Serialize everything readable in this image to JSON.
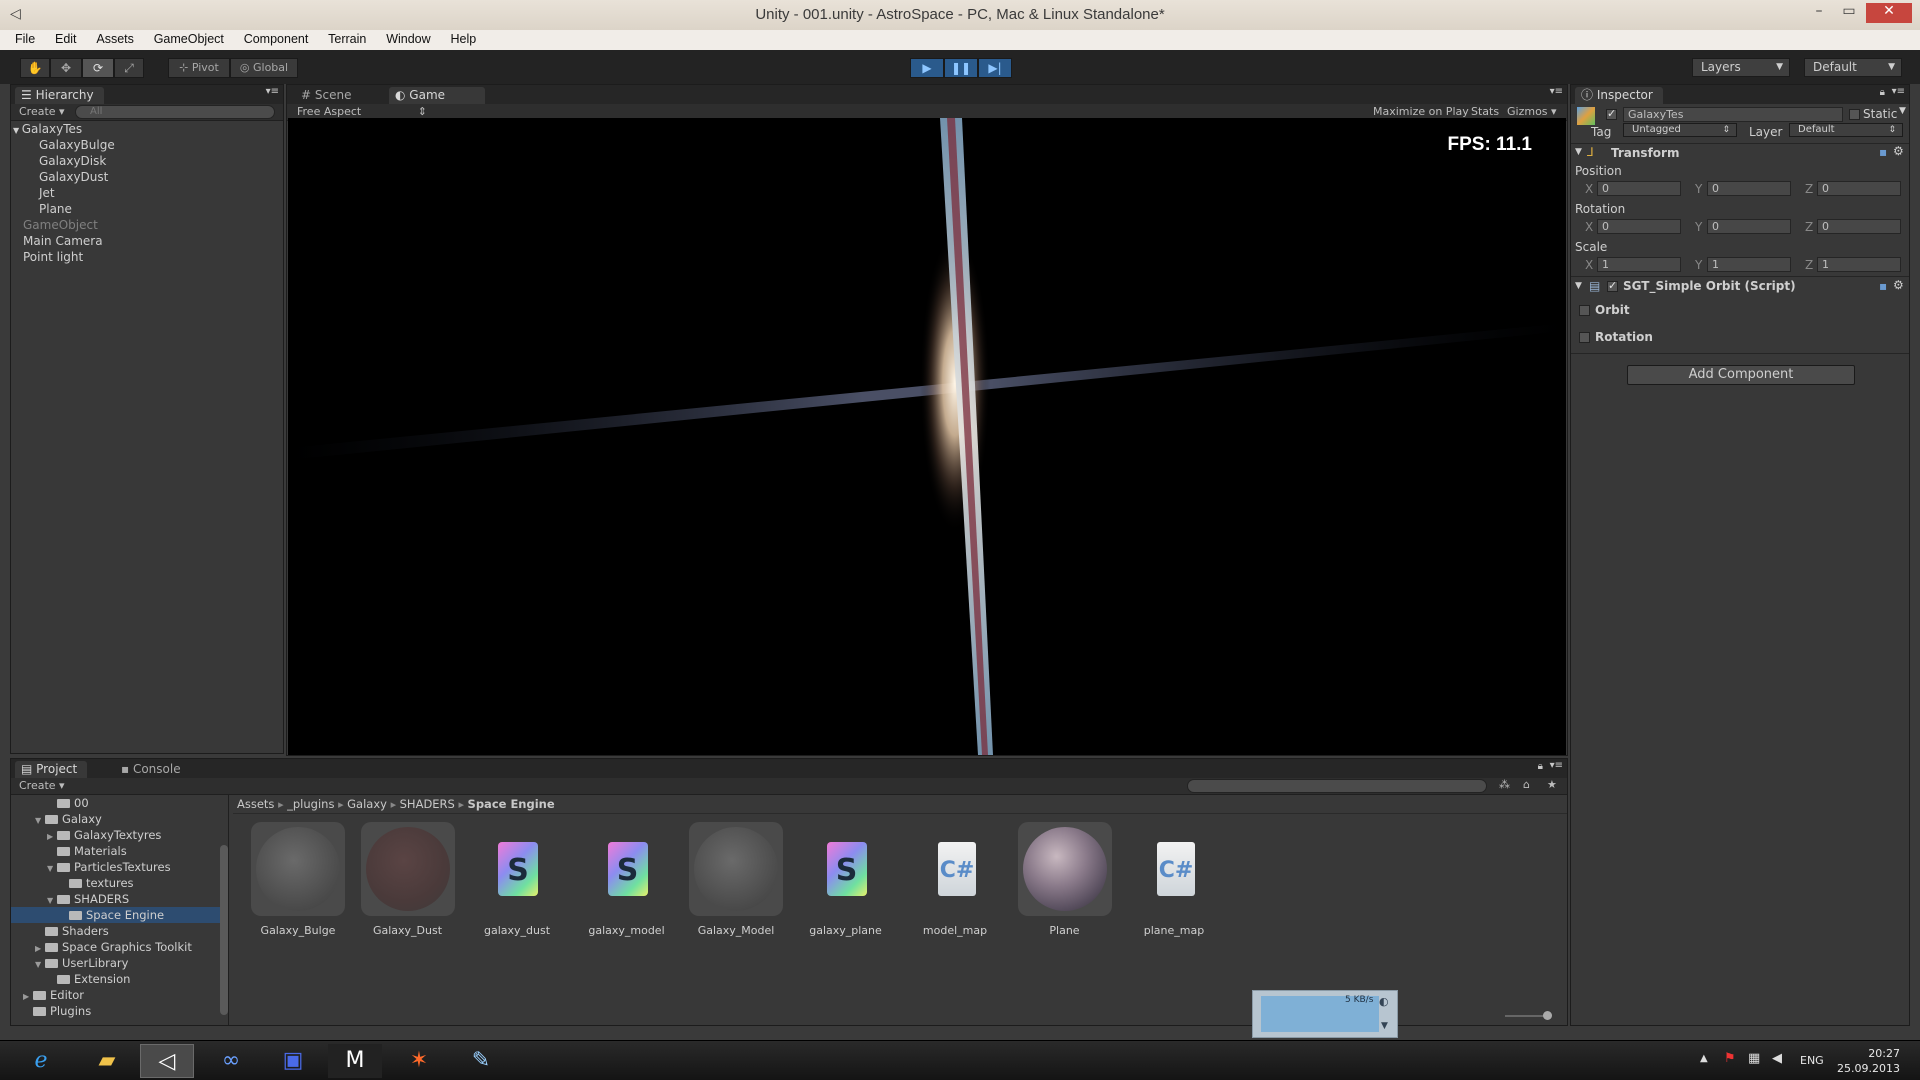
{
  "window": {
    "title": "Unity - 001.unity - AstroSpace - PC, Mac & Linux Standalone*"
  },
  "menu": [
    "File",
    "Edit",
    "Assets",
    "GameObject",
    "Component",
    "Terrain",
    "Window",
    "Help"
  ],
  "toolbar": {
    "pivot": "Pivot",
    "global": "Global",
    "layers": "Layers",
    "layout": "Default"
  },
  "hierarchy": {
    "tab": "Hierarchy",
    "create": "Create",
    "search_placeholder": "All",
    "items": [
      {
        "label": "GalaxyTes",
        "indent": 0,
        "dim": false,
        "expanded": true
      },
      {
        "label": "GalaxyBulge",
        "indent": 1,
        "dim": false
      },
      {
        "label": "GalaxyDisk",
        "indent": 1,
        "dim": false
      },
      {
        "label": "GalaxyDust",
        "indent": 1,
        "dim": false
      },
      {
        "label": "Jet",
        "indent": 1,
        "dim": false
      },
      {
        "label": "Plane",
        "indent": 1,
        "dim": false
      },
      {
        "label": "GameObject",
        "indent": 0,
        "dim": true
      },
      {
        "label": "Main Camera",
        "indent": 0,
        "dim": false
      },
      {
        "label": "Point light",
        "indent": 0,
        "dim": false
      }
    ]
  },
  "views": {
    "scene_tab": "Scene",
    "game_tab": "Game",
    "aspect": "Free Aspect",
    "maximize": "Maximize on Play",
    "stats": "Stats",
    "gizmos": "Gizmos",
    "fps": "FPS: 11.1"
  },
  "inspector": {
    "tab": "Inspector",
    "object_name": "GalaxyTes",
    "static": "Static",
    "tag_label": "Tag",
    "tag_value": "Untagged",
    "layer_label": "Layer",
    "layer_value": "Default",
    "transform": {
      "title": "Transform",
      "position_label": "Position",
      "rotation_label": "Rotation",
      "scale_label": "Scale",
      "position": {
        "x": "0",
        "y": "0",
        "z": "0"
      },
      "rotation": {
        "x": "0",
        "y": "0",
        "z": "0"
      },
      "scale": {
        "x": "1",
        "y": "1",
        "z": "1"
      }
    },
    "script": {
      "title": "SGT_Simple Orbit (Script)",
      "orbit": "Orbit",
      "rotation": "Rotation"
    },
    "add_component": "Add Component"
  },
  "project": {
    "tab": "Project",
    "console_tab": "Console",
    "create": "Create",
    "tree": [
      {
        "label": "00",
        "depth": 3,
        "arrow": ""
      },
      {
        "label": "Galaxy",
        "depth": 2,
        "arrow": "▼"
      },
      {
        "label": "GalaxyTextyres",
        "depth": 3,
        "arrow": "▶"
      },
      {
        "label": "Materials",
        "depth": 3,
        "arrow": ""
      },
      {
        "label": "ParticlesTextures",
        "depth": 3,
        "arrow": "▼"
      },
      {
        "label": "textures",
        "depth": 4,
        "arrow": ""
      },
      {
        "label": "SHADERS",
        "depth": 3,
        "arrow": "▼"
      },
      {
        "label": "Space Engine",
        "depth": 4,
        "arrow": "",
        "selected": true
      },
      {
        "label": "Shaders",
        "depth": 2,
        "arrow": ""
      },
      {
        "label": "Space Graphics Toolkit",
        "depth": 2,
        "arrow": "▶"
      },
      {
        "label": "UserLibrary",
        "depth": 2,
        "arrow": "▼"
      },
      {
        "label": "Extension",
        "depth": 3,
        "arrow": ""
      },
      {
        "label": "Editor",
        "depth": 1,
        "arrow": "▶"
      },
      {
        "label": "Plugins",
        "depth": 1,
        "arrow": ""
      }
    ],
    "breadcrumb": [
      "Assets",
      "_plugins",
      "Galaxy",
      "SHADERS",
      "Space Engine"
    ],
    "assets": [
      {
        "label": "Galaxy_Bulge",
        "kind": "material"
      },
      {
        "label": "Galaxy_Dust",
        "kind": "material-red"
      },
      {
        "label": "galaxy_dust",
        "kind": "shader"
      },
      {
        "label": "galaxy_model",
        "kind": "shader"
      },
      {
        "label": "Galaxy_Model",
        "kind": "material"
      },
      {
        "label": "galaxy_plane",
        "kind": "shader"
      },
      {
        "label": "model_map",
        "kind": "script"
      },
      {
        "label": "Plane",
        "kind": "planet"
      },
      {
        "label": "plane_map",
        "kind": "script"
      }
    ],
    "netspeed": "5 KB/s"
  },
  "taskbar": {
    "lang": "ENG",
    "time": "20:27",
    "date": "25.09.2013"
  }
}
